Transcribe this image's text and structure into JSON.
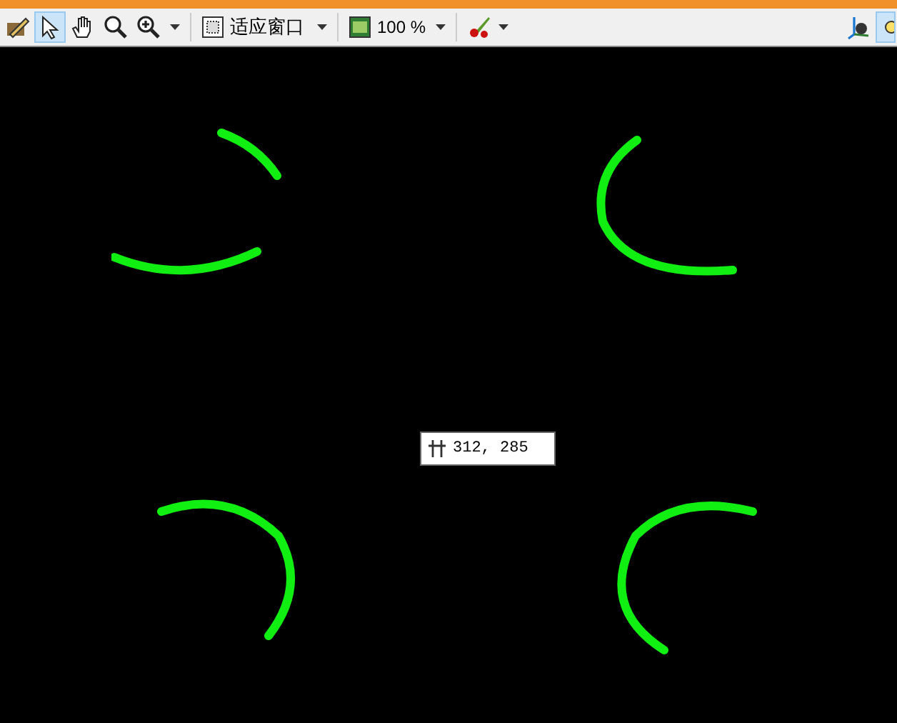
{
  "toolbar": {
    "tools": [
      {
        "kind": "edit",
        "selected": false
      },
      {
        "kind": "pointer",
        "selected": true
      },
      {
        "kind": "hand",
        "selected": false
      },
      {
        "kind": "magnifier",
        "selected": false
      },
      {
        "kind": "zoom-in",
        "selected": false
      }
    ],
    "fit_dropdown": {
      "value": "适应窗口"
    },
    "zoom_dropdown": {
      "value": "100 %"
    }
  },
  "canvas": {
    "coordinate_tooltip": "312, 285"
  }
}
